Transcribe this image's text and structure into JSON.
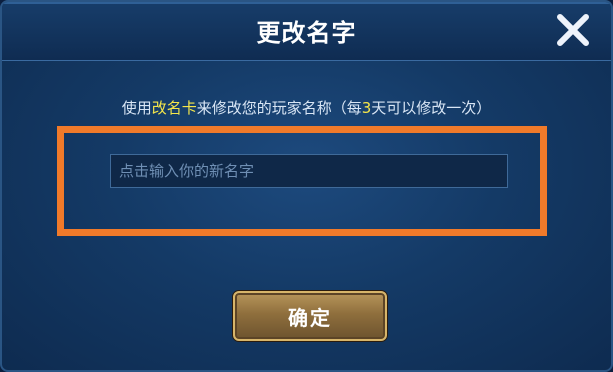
{
  "dialog": {
    "title": "更改名字",
    "close_icon": "close-icon",
    "hint": {
      "prefix": "使用",
      "highlight": "改名卡",
      "middle": "来修改您的玩家名称（每",
      "count": "3",
      "suffix": "天可以修改一次）"
    },
    "input": {
      "value": "",
      "placeholder": "点击输入你的新名字"
    },
    "confirm_label": "确定",
    "colors": {
      "highlight_text": "#f5e64a",
      "annotation_box": "#f07a2a",
      "button_border": "#d7b56a"
    }
  }
}
